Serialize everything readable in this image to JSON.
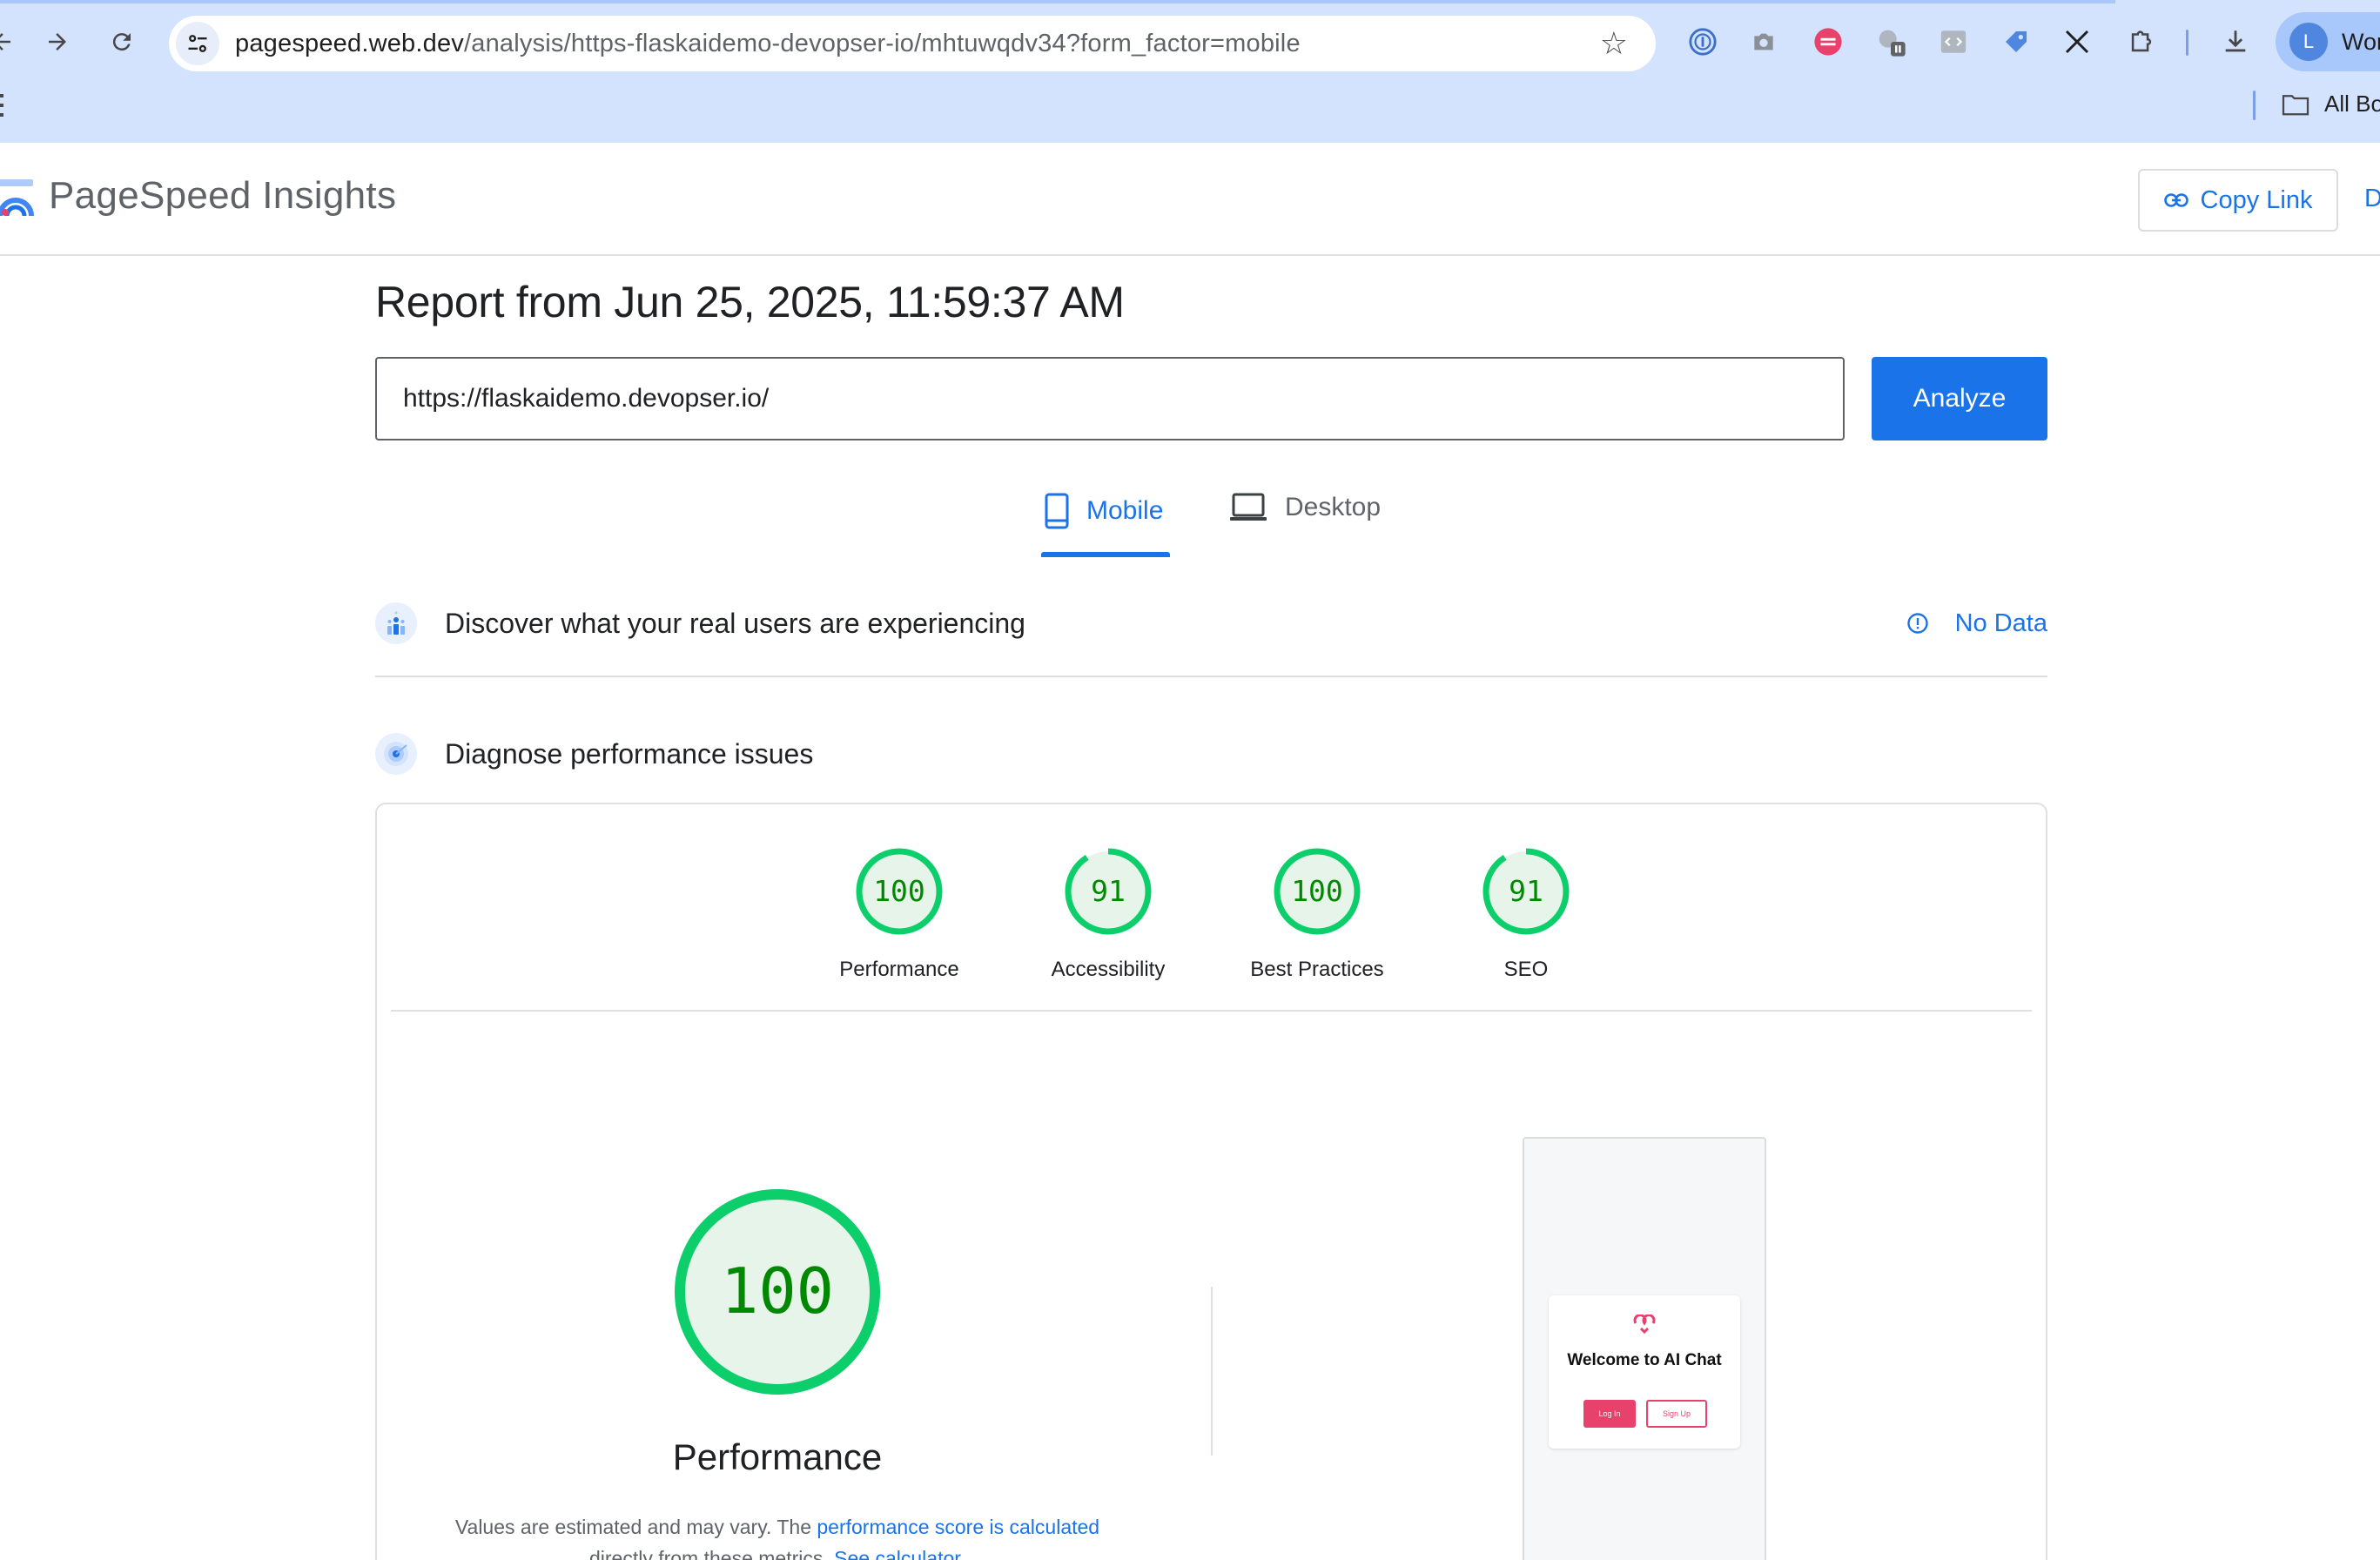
{
  "browser": {
    "url_host": "pagespeed.web.dev",
    "url_path": "/analysis/https-flaskaidemo-devopser-io/mhtuwqdv34?form_factor=mobile",
    "profile_initial": "L",
    "profile_label": "Wor",
    "bookmarks_all": "All Bo"
  },
  "header": {
    "title": "PageSpeed Insights",
    "copy_link_label": "Copy Link",
    "truncated_label": "D"
  },
  "report": {
    "title": "Report from Jun 25, 2025, 11:59:37 AM",
    "url_value": "https://flaskaidemo.devopser.io/",
    "analyze_label": "Analyze"
  },
  "tabs": [
    {
      "label": "Mobile",
      "active": true
    },
    {
      "label": "Desktop",
      "active": false
    }
  ],
  "sections": {
    "real_users": "Discover what your real users are experiencing",
    "no_data": "No Data",
    "diagnose": "Diagnose performance issues"
  },
  "scores": [
    {
      "label": "Performance",
      "value": 100
    },
    {
      "label": "Accessibility",
      "value": 91
    },
    {
      "label": "Best Practices",
      "value": 100
    },
    {
      "label": "SEO",
      "value": 91
    }
  ],
  "performance": {
    "score": 100,
    "label": "Performance",
    "note_prefix": "Values are estimated and may vary. The ",
    "note_link1": "performance score is calculated",
    "note_middle": " directly from these metrics. ",
    "note_link2": "See calculator."
  },
  "screenshot": {
    "title": "Welcome to AI Chat",
    "login_label": "Log In",
    "signup_label": "Sign Up"
  },
  "colors": {
    "accent": "#1a73e8",
    "pass": "#0cce6b",
    "pass_text": "#008800",
    "pass_fill": "#e6f4ea"
  }
}
